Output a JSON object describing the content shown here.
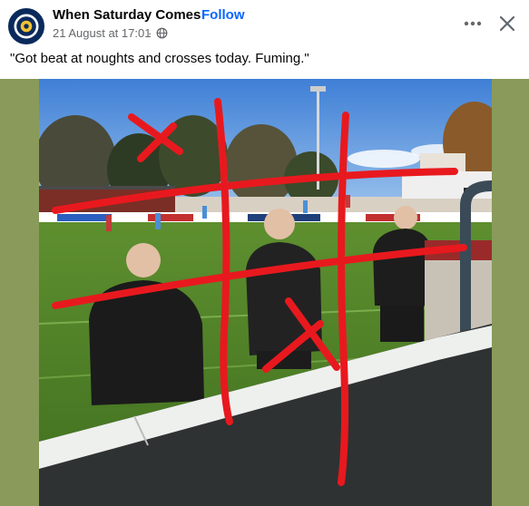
{
  "post": {
    "page_name": "When Saturday Comes",
    "separator": "·",
    "follow_label": "Follow",
    "timestamp": "21 August at 17:01",
    "timestamp_separator": "·",
    "caption": "\"Got beat at noughts and crosses today. Fuming.\""
  },
  "icons": {
    "avatar": "when-saturday-comes-logo",
    "privacy": "globe-icon",
    "more": "more-options-icon",
    "close": "close-icon"
  },
  "colors": {
    "follow": "#0866ff",
    "meta_text": "#65676b",
    "media_background": "#8a9a5b",
    "drawing": "#e8191e"
  }
}
